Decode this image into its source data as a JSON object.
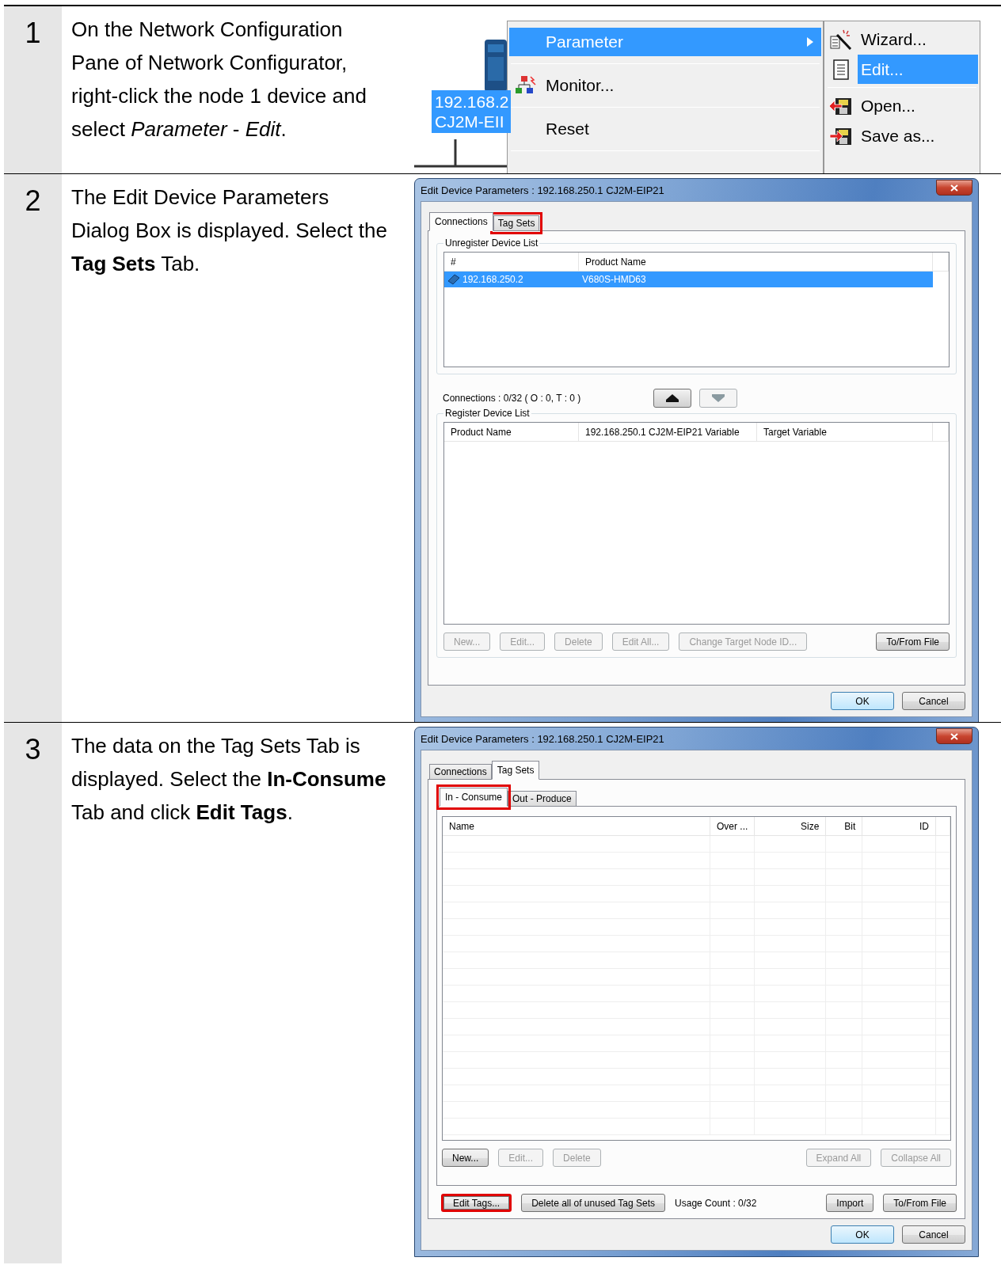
{
  "steps": [
    {
      "number": "1",
      "instruction": "On the Network Configuration Pane of Network Configurator, right-click the node 1 device and select *Parameter* - *Edit*.",
      "screenshot": {
        "kind": "context_menu",
        "node_label": [
          "192.168.2",
          "CJ2M-EII"
        ],
        "menu": [
          {
            "label": "Parameter",
            "selected": true,
            "submenu": true
          },
          {
            "label": "Monitor...",
            "selected": false,
            "submenu": false
          },
          {
            "label": "Reset",
            "selected": false,
            "submenu": false
          }
        ],
        "submenu": [
          {
            "label": "Wizard...",
            "selected": false
          },
          {
            "label": "Edit...",
            "selected": true
          },
          {
            "label": "Open...",
            "selected": false
          },
          {
            "label": "Save as...",
            "selected": false
          }
        ]
      }
    },
    {
      "number": "2",
      "instruction": "The Edit Device Parameters Dialog Box is displayed. Select the **Tag Sets** Tab.",
      "screenshot": {
        "kind": "dialog",
        "title": "Edit Device Parameters : 192.168.250.1 CJ2M-EIP21",
        "tabs": [
          {
            "label": "Connections",
            "selected": true,
            "highlighted": false
          },
          {
            "label": "Tag Sets",
            "selected": false,
            "highlighted": true
          }
        ],
        "content": {
          "kind": "connections",
          "unregister_label": "Unregister Device List",
          "unregister_columns": [
            "#",
            "Product Name"
          ],
          "unregister_rows": [
            {
              "cells": [
                "192.168.250.2",
                "V680S-HMD63"
              ],
              "selected": true
            }
          ],
          "connections_text": "Connections :  0/32 ( O : 0, T : 0 )",
          "register_label": "Register Device List",
          "register_columns": [
            "Product Name",
            "192.168.250.1 CJ2M-EIP21 Variable",
            "Target Variable"
          ],
          "buttons_left": [
            {
              "label": "New...",
              "disabled": true,
              "highlighted": false
            },
            {
              "label": "Edit...",
              "disabled": true,
              "highlighted": false
            },
            {
              "label": "Delete",
              "disabled": true,
              "highlighted": false
            },
            {
              "label": "Edit All...",
              "disabled": true,
              "highlighted": false
            },
            {
              "label": "Change Target Node ID...",
              "disabled": true,
              "highlighted": false
            }
          ],
          "buttons_right": [
            {
              "label": "To/From File",
              "disabled": false,
              "highlighted": false
            }
          ]
        },
        "footer": [
          {
            "label": "OK",
            "default": true
          },
          {
            "label": "Cancel",
            "default": false
          }
        ]
      }
    },
    {
      "number": "3",
      "instruction": "The data on the Tag Sets Tab is displayed. Select the **In-Consume** Tab and click **Edit Tags**.",
      "screenshot": {
        "kind": "dialog",
        "title": "Edit Device Parameters : 192.168.250.1 CJ2M-EIP21",
        "tabs": [
          {
            "label": "Connections",
            "selected": false,
            "highlighted": false
          },
          {
            "label": "Tag Sets",
            "selected": true,
            "highlighted": false
          }
        ],
        "content": {
          "kind": "tag_sets",
          "subtabs": [
            {
              "label": "In - Consume",
              "selected": true,
              "highlighted": true
            },
            {
              "label": "Out - Produce",
              "selected": false,
              "highlighted": false
            }
          ],
          "columns": [
            "Name",
            "Over ...",
            "Size",
            "Bit",
            "ID"
          ],
          "buttons_left": [
            {
              "label": "New...",
              "disabled": false,
              "highlighted": false
            },
            {
              "label": "Edit...",
              "disabled": true,
              "highlighted": false
            },
            {
              "label": "Delete",
              "disabled": true,
              "highlighted": false
            }
          ],
          "buttons_right": [
            {
              "label": "Expand All",
              "disabled": true,
              "highlighted": false
            },
            {
              "label": "Collapse All",
              "disabled": true,
              "highlighted": false
            }
          ],
          "bottom_left": [
            {
              "label": "Edit Tags...",
              "disabled": false,
              "highlighted": true
            },
            {
              "label": "Delete all of unused Tag Sets",
              "disabled": false,
              "highlighted": false
            }
          ],
          "usage_text": "Usage Count :  0/32",
          "bottom_right": [
            {
              "label": "Import",
              "disabled": false,
              "highlighted": false
            },
            {
              "label": "To/From File",
              "disabled": false,
              "highlighted": false
            }
          ]
        },
        "footer": [
          {
            "label": "OK",
            "default": true
          },
          {
            "label": "Cancel",
            "default": false
          }
        ]
      }
    }
  ]
}
